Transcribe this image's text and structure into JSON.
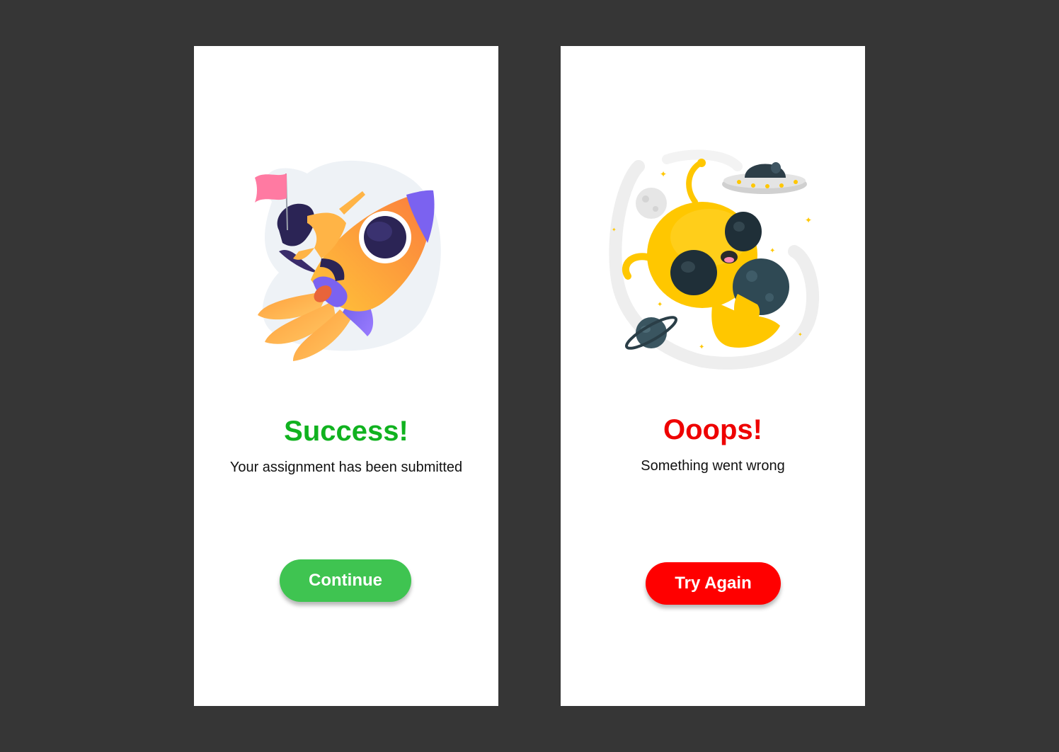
{
  "colors": {
    "background": "#363636",
    "card": "#ffffff",
    "success": "#10b21f",
    "success_button": "#3fc451",
    "error": "#ee0000",
    "error_button": "#ff0000"
  },
  "success_screen": {
    "title": "Success!",
    "message": "Your assignment has been submitted",
    "button_label": "Continue",
    "illustration": "rocket-launch-illustration"
  },
  "error_screen": {
    "title": "Ooops!",
    "message": "Something went wrong",
    "button_label": "Try Again",
    "illustration": "alien-space-illustration"
  }
}
